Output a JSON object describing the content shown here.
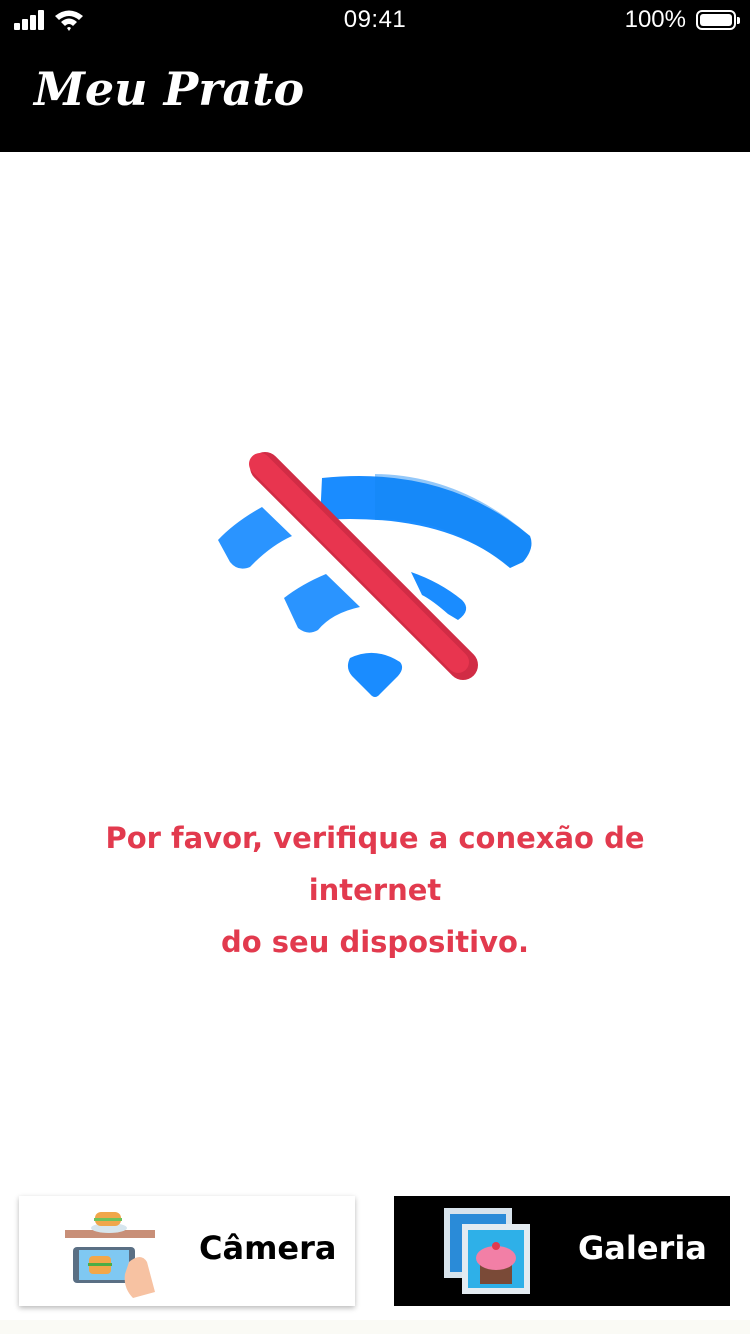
{
  "status_bar": {
    "time": "09:41",
    "battery_percent": "100%",
    "signal_bars": 4,
    "wifi_icon": "wifi-icon"
  },
  "header": {
    "title": "Meu Prato"
  },
  "offline": {
    "icon": "wifi-off-icon",
    "message_line1": "Por favor, verifique a conexão de internet",
    "message_line2": "do seu dispositivo.",
    "colors": {
      "wifi": "#1a8cff",
      "slash": "#e8354f",
      "message": "#e23a4e"
    }
  },
  "actions": {
    "camera": {
      "label": "Câmera",
      "icon": "camera-food-icon"
    },
    "gallery": {
      "label": "Galeria",
      "icon": "gallery-cupcake-icon"
    }
  }
}
